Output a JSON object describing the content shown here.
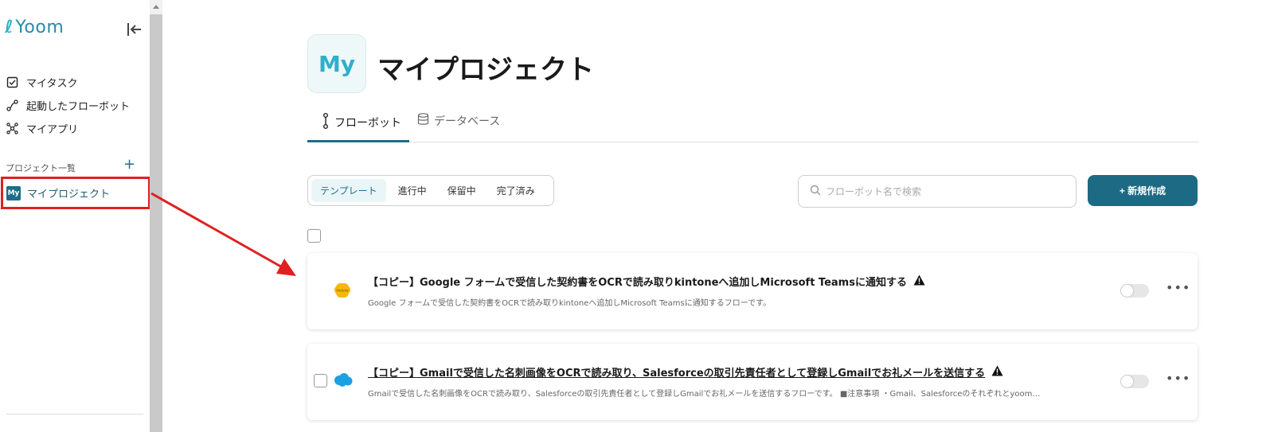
{
  "app": {
    "logo_text": "Yoom"
  },
  "sidebar": {
    "nav": [
      {
        "label": "マイタスク",
        "icon": "checkbox-icon"
      },
      {
        "label": "起動したフローボット",
        "icon": "flow-icon"
      },
      {
        "label": "マイアプリ",
        "icon": "apps-icon"
      }
    ],
    "section_title": "プロジェクト一覧",
    "add_label": "+",
    "project": {
      "badge": "My",
      "label": "マイプロジェクト"
    }
  },
  "main": {
    "project_icon": "My",
    "title": "マイプロジェクト",
    "tabs": [
      {
        "label": "フローボット",
        "icon": "flow-node-icon"
      },
      {
        "label": "データベース",
        "icon": "database-icon"
      }
    ],
    "filters": [
      "テンプレート",
      "進行中",
      "保留中",
      "完了済み"
    ],
    "search_placeholder": "フローボット名で検索",
    "new_button": "+ 新規作成",
    "cards": [
      {
        "title": "【コピー】Google フォームで受信した契約書をOCRで読み取りkintoneへ追加しMicrosoft Teamsに通知する",
        "description": "Google フォームで受信した契約書をOCRで読み取りkintoneへ追加しMicrosoft Teamsに通知するフローです。",
        "app_icon": "kintone-icon",
        "warning_icon": "warning-icon"
      },
      {
        "title": "【コピー】Gmailで受信した名刺画像をOCRで読み取り、Salesforceの取引先責任者として登録しGmailでお礼メールを送信する",
        "description": "Gmailで受信した名刺画像をOCRで読み取り、Salesforceの取引先責任者として登録しGmailでお礼メールを送信するフローです。 ■注意事項 ・Gmail、Salesforceのそれぞれとyoom…",
        "app_icon": "salesforce-icon",
        "warning_icon": "warning-icon"
      }
    ]
  },
  "colors": {
    "accent": "#1d6a84",
    "annotation": "#e02020",
    "brand": "#2db3c9"
  }
}
